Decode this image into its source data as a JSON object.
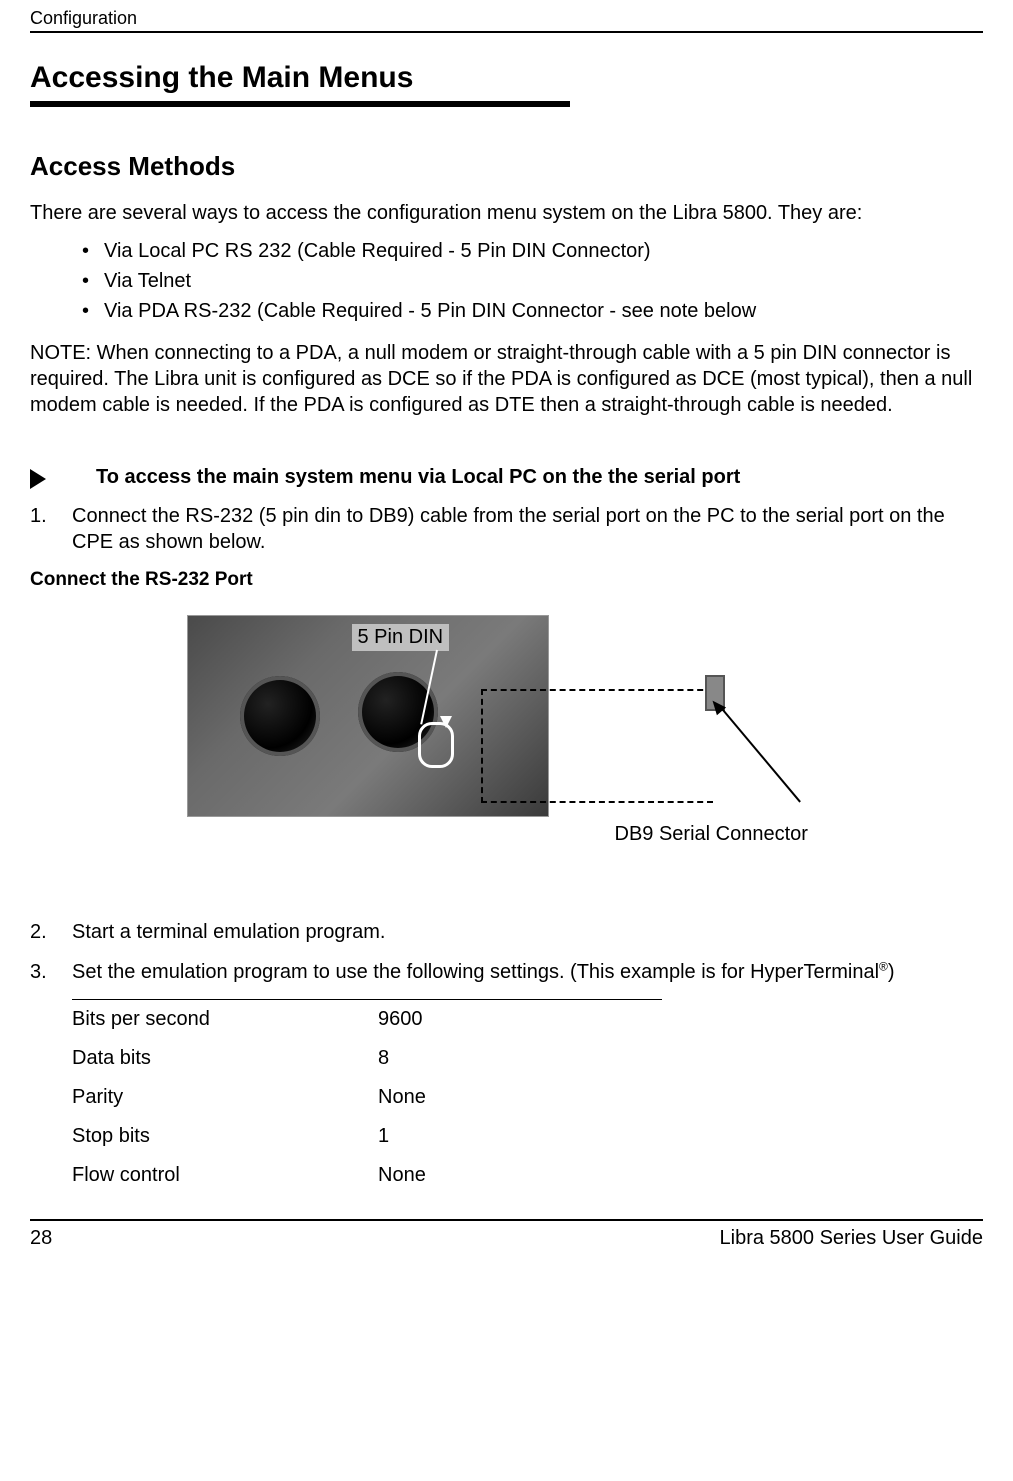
{
  "header": {
    "running": "Configuration"
  },
  "title": "Accessing the Main Menus",
  "subsection": "Access Methods",
  "intro": "There are several ways to access the configuration menu system on the Libra 5800. They are:",
  "bullets": [
    "Via Local PC RS 232 (Cable Required - 5 Pin DIN Connector)",
    "Via Telnet",
    "Via PDA RS-232 (Cable Required - 5 Pin DIN Connector - see note below"
  ],
  "note": "NOTE: When connecting to a PDA, a null modem or straight-through cable with a 5 pin DIN connector is required. The Libra unit is configured as DCE so if the PDA is configured as DCE (most typical), then a null modem cable is needed. If the PDA is configured as DTE then a straight-through cable is needed.",
  "procedure_title": "To access the main system menu via Local PC on the the serial port",
  "steps": {
    "s1_num": "1.",
    "s1": "Connect the RS-232 (5 pin din to DB9) cable from the serial port on the PC to the serial port on the CPE as shown below.",
    "s2_num": "2.",
    "s2": "Start a terminal emulation program.",
    "s3_num": "3.",
    "s3_prefix": "Set the emulation program to use the following settings. (This example is for HyperTerminal",
    "s3_suffix": ")"
  },
  "figure": {
    "caption": "Connect the RS-232 Port",
    "label_din": "5 Pin DIN",
    "label_db9": "DB9 Serial Connector"
  },
  "settings": [
    {
      "k": "Bits per second",
      "v": "9600"
    },
    {
      "k": "Data bits",
      "v": "8"
    },
    {
      "k": "Parity",
      "v": "None"
    },
    {
      "k": "Stop bits",
      "v": "1"
    },
    {
      "k": "Flow control",
      "v": "None"
    }
  ],
  "footer": {
    "page": "28",
    "guide": "Libra 5800 Series User Guide"
  },
  "sup": "®"
}
